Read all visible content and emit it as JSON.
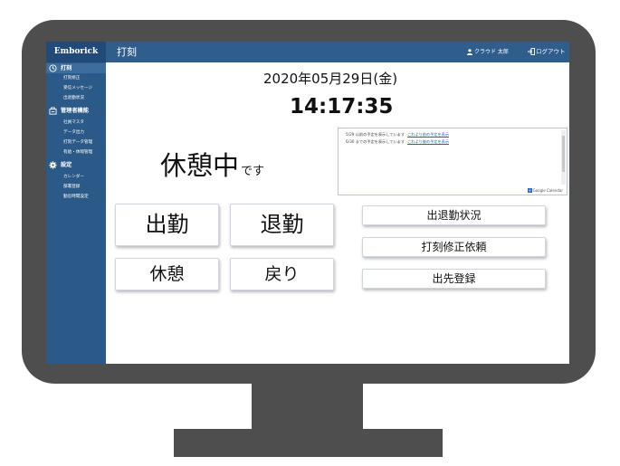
{
  "app": {
    "brand": "Emborick",
    "page_title": "打刻",
    "user_name": "クラウド 太郎",
    "logout_label": "ログアウト"
  },
  "sidebar": {
    "sections": [
      {
        "label": "打刻",
        "icon": "stamp-icon",
        "items": [
          "打刻修正",
          "受信メッセージ",
          "出退勤状況"
        ]
      },
      {
        "label": "管理者機能",
        "icon": "admin-icon",
        "items": [
          "社員マスタ",
          "データ出力",
          "打刻データ管理",
          "有給・休暇管理"
        ]
      },
      {
        "label": "設定",
        "icon": "gear-icon",
        "items": [
          "カレンダー",
          "部署登録",
          "勤怠時間設定"
        ]
      }
    ]
  },
  "clock": {
    "date": "2020年05月29日(金)",
    "time": "14:17:35"
  },
  "status": {
    "main": "休憩中",
    "suffix": "です"
  },
  "calendar": {
    "lines": [
      {
        "text": "5/29 以前の予定を表示しています",
        "link": "これより前の予定を表示"
      },
      {
        "text": "6/30 までの予定を表示しています",
        "link": "これより後の予定を表示"
      }
    ],
    "badge": "Google Calendar"
  },
  "buttons": {
    "clock_in": "出勤",
    "clock_out": "退勤",
    "break": "休憩",
    "return": "戻り",
    "attendance_status": "出退勤状況",
    "correction_request": "打刻修正依頼",
    "destination_register": "出先登録"
  }
}
